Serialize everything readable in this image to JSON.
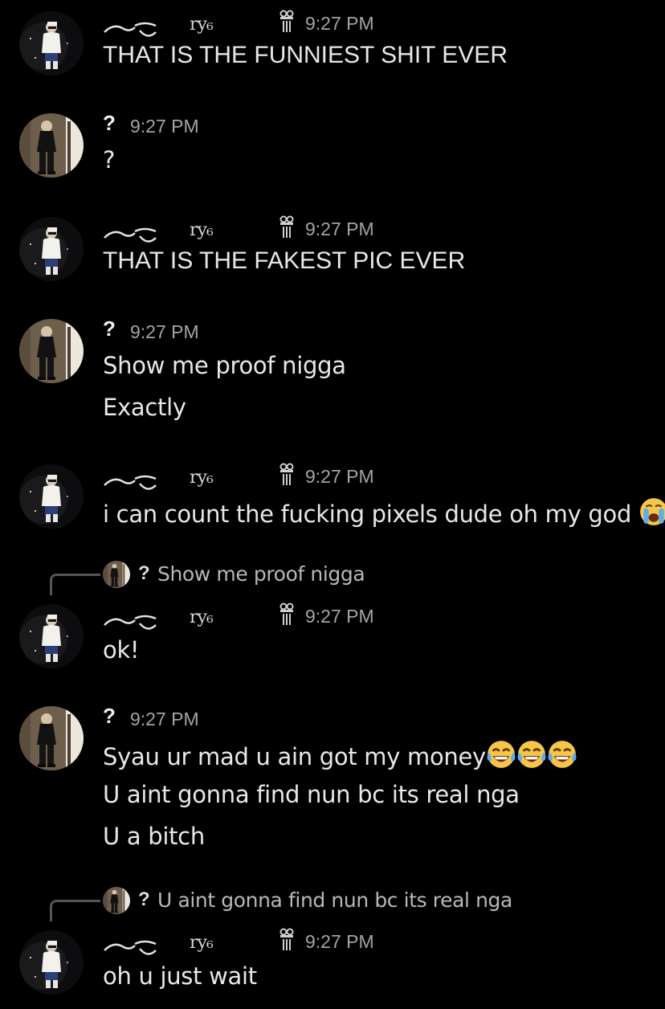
{
  "users": {
    "ry": {
      "name": "ry₆",
      "time": "9:27 PM"
    },
    "q": {
      "name": "?",
      "time": "9:27 PM"
    }
  },
  "messages": [
    {
      "lines": [
        "THAT IS THE FUNNIEST SHIT EVER"
      ]
    },
    {
      "lines": [
        "?"
      ]
    },
    {
      "lines": [
        "THAT IS THE FAKEST PIC EVER"
      ]
    },
    {
      "lines": [
        "Show me proof nigga",
        "Exactly"
      ]
    },
    {
      "lines": [
        "i can count the fucking pixels dude oh my god"
      ]
    },
    {
      "reply": {
        "author": "?",
        "text": "Show me proof nigga"
      },
      "lines": [
        "ok!"
      ]
    },
    {
      "lines": [
        "Syau ur mad u ain got my money",
        "U aint gonna find nun bc its real nga",
        "U a bitch"
      ]
    },
    {
      "reply": {
        "author": "?",
        "text": "U aint gonna find nun bc its real nga"
      },
      "lines": [
        "oh u just wait"
      ]
    }
  ],
  "emojis": {
    "crying": "loudly-crying-face",
    "laughing": "face-with-tears-of-joy"
  },
  "colors": {
    "background": "#000000",
    "text": "#e8e8eb",
    "timestamp": "#a3a3aa",
    "reply_spine": "#55565c"
  }
}
